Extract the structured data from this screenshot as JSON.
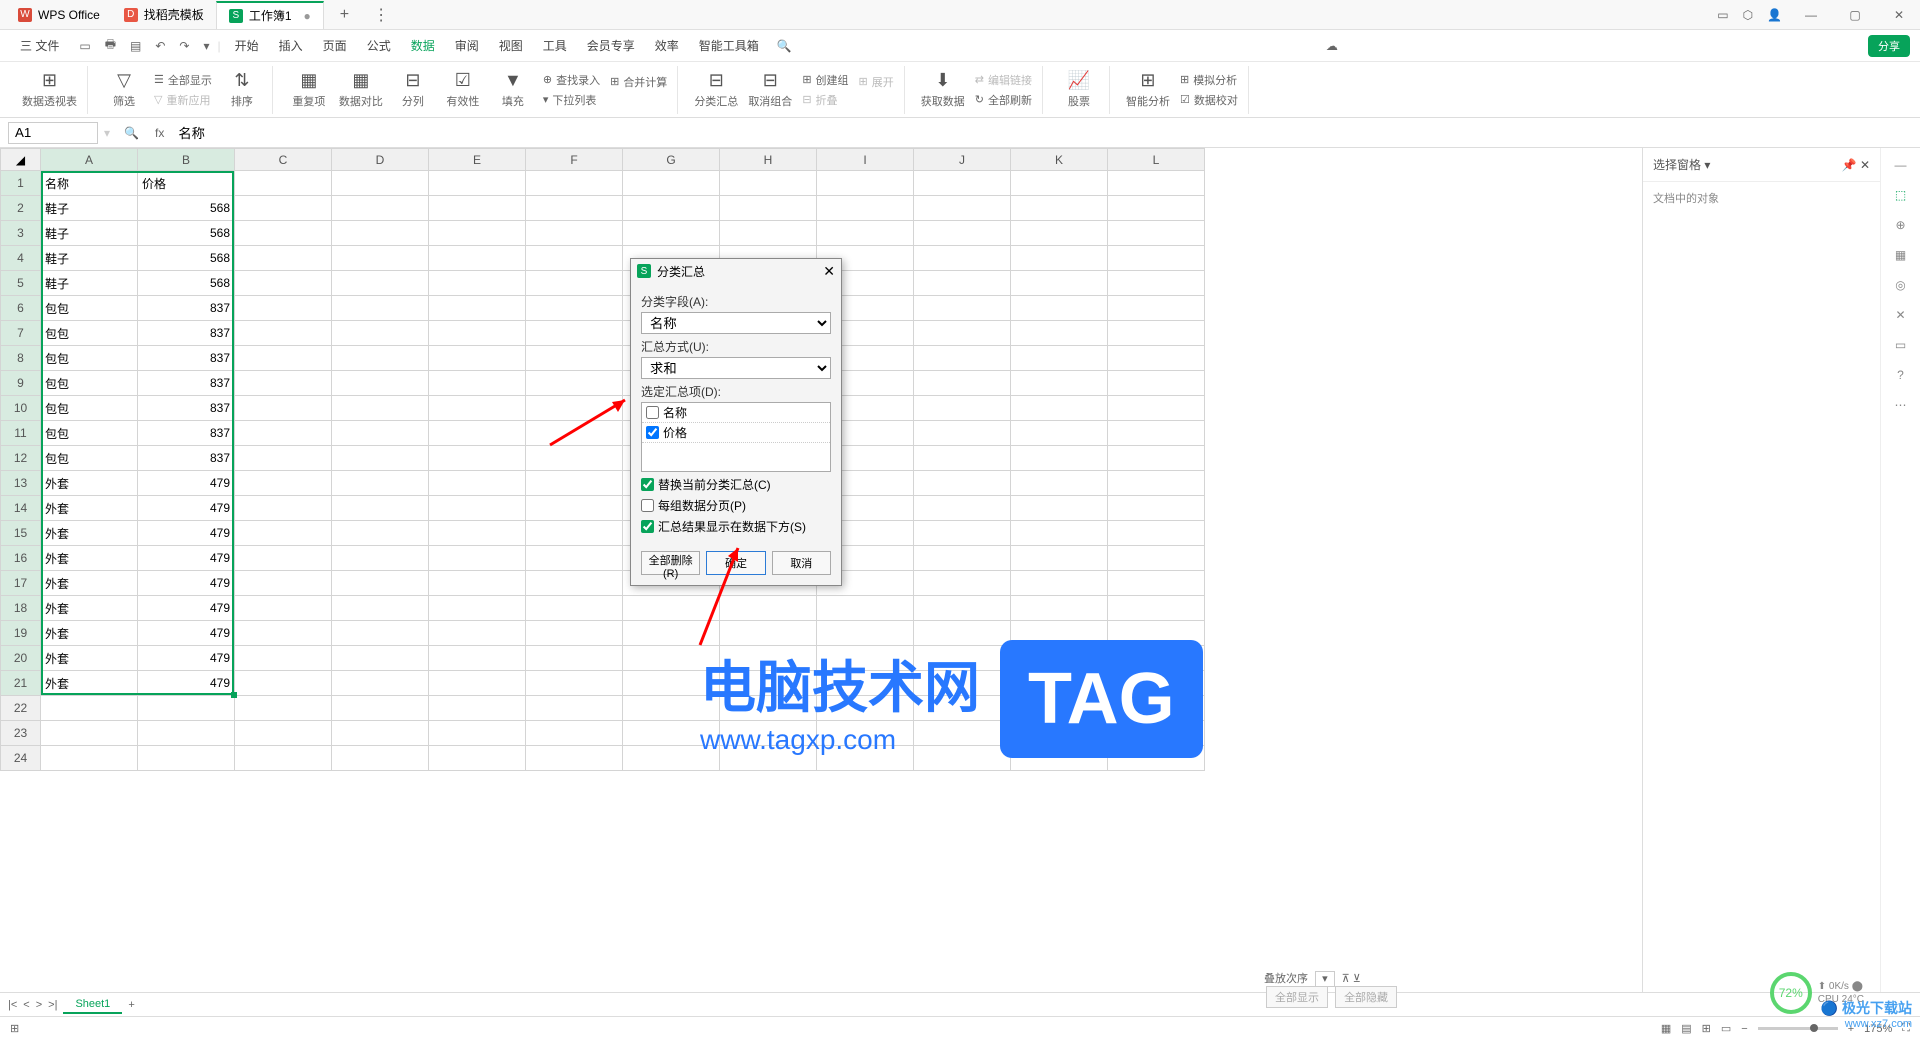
{
  "tabs": {
    "wps": "WPS Office",
    "template": "找稻壳模板",
    "workbook": "工作簿1"
  },
  "menu": {
    "file": "三 文件",
    "items": [
      "开始",
      "插入",
      "页面",
      "公式",
      "数据",
      "审阅",
      "视图",
      "工具",
      "会员专享",
      "效率",
      "智能工具箱"
    ],
    "active_index": 4,
    "share": "分享"
  },
  "ribbon": {
    "pivot": "数据透视表",
    "filter": "筛选",
    "show_all": "全部显示",
    "refilter": "重新应用",
    "sort": "排序",
    "dup": "重复项",
    "compare": "数据对比",
    "split": "分列",
    "validity": "有效性",
    "fill": "填充",
    "lookup": "查找录入",
    "consolidate": "合并计算",
    "dropdown": "下拉列表",
    "subtotal": "分类汇总",
    "ungroup": "取消组合",
    "create_group": "创建组",
    "expand": "展开",
    "collapse": "折叠",
    "getdata": "获取数据",
    "refresh_all": "全部刷新",
    "edit_link": "编辑链接",
    "stock": "股票",
    "smart": "智能分析",
    "validate": "数据校对",
    "simulate": "模拟分析"
  },
  "formula": {
    "cell": "A1",
    "fx": "fx",
    "value": "名称"
  },
  "columns": [
    "A",
    "B",
    "C",
    "D",
    "E",
    "F",
    "G",
    "H",
    "I",
    "J",
    "K",
    "L"
  ],
  "header_row": {
    "A": "名称",
    "B": "价格"
  },
  "data_rows": [
    {
      "A": "鞋子",
      "B": "568"
    },
    {
      "A": "鞋子",
      "B": "568"
    },
    {
      "A": "鞋子",
      "B": "568"
    },
    {
      "A": "鞋子",
      "B": "568"
    },
    {
      "A": "包包",
      "B": "837"
    },
    {
      "A": "包包",
      "B": "837"
    },
    {
      "A": "包包",
      "B": "837"
    },
    {
      "A": "包包",
      "B": "837"
    },
    {
      "A": "包包",
      "B": "837"
    },
    {
      "A": "包包",
      "B": "837"
    },
    {
      "A": "包包",
      "B": "837"
    },
    {
      "A": "外套",
      "B": "479"
    },
    {
      "A": "外套",
      "B": "479"
    },
    {
      "A": "外套",
      "B": "479"
    },
    {
      "A": "外套",
      "B": "479"
    },
    {
      "A": "外套",
      "B": "479"
    },
    {
      "A": "外套",
      "B": "479"
    },
    {
      "A": "外套",
      "B": "479"
    },
    {
      "A": "外套",
      "B": "479"
    },
    {
      "A": "外套",
      "B": "479"
    }
  ],
  "extra_rows": 3,
  "dialog": {
    "title": "分类汇总",
    "field_label": "分类字段(A):",
    "field_value": "名称",
    "func_label": "汇总方式(U):",
    "func_value": "求和",
    "items_label": "选定汇总项(D):",
    "item1": "名称",
    "item2": "价格",
    "replace": "替换当前分类汇总(C)",
    "pagebreak": "每组数据分页(P)",
    "below": "汇总结果显示在数据下方(S)",
    "remove": "全部删除(R)",
    "ok": "确定",
    "cancel": "取消"
  },
  "sidepanel": {
    "title": "选择窗格",
    "sub": "文档中的对象"
  },
  "order": {
    "label": "叠放次序",
    "show_all": "全部显示",
    "hide_all": "全部隐藏"
  },
  "sheet": {
    "name": "Sheet1"
  },
  "status": {
    "zoom": "175%"
  },
  "watermark": {
    "text": "电脑技术网",
    "url": "www.tagxp.com",
    "tag": "TAG"
  },
  "cpu": {
    "pct": "72%",
    "speed": "0K/s",
    "temp": "CPU 24°C"
  },
  "dl": {
    "name": "极光下载站",
    "url": "www.xz7.com"
  }
}
